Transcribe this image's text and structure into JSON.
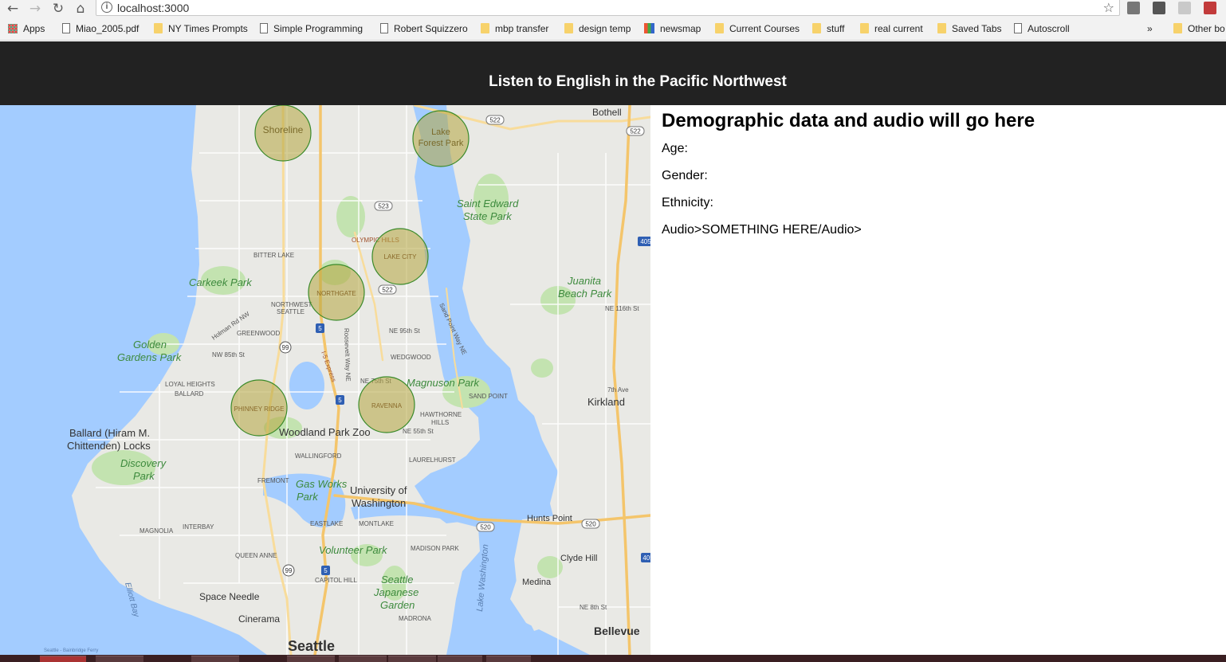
{
  "browser": {
    "url": "localhost:3000",
    "bookmarks": [
      {
        "label": "Apps",
        "icon": "apps-grid-icon"
      },
      {
        "label": "Miao_2005.pdf",
        "icon": "page-icon"
      },
      {
        "label": "NY Times Prompts",
        "icon": "folder-icon"
      },
      {
        "label": "Simple Programming",
        "icon": "page-icon"
      },
      {
        "label": "Robert Squizzero",
        "icon": "page-icon"
      },
      {
        "label": "mbp transfer",
        "icon": "folder-icon"
      },
      {
        "label": "design temp",
        "icon": "folder-icon"
      },
      {
        "label": "newsmap",
        "icon": "newsmap-icon"
      },
      {
        "label": "Current Courses",
        "icon": "folder-icon"
      },
      {
        "label": "stuff",
        "icon": "folder-icon"
      },
      {
        "label": "real current",
        "icon": "folder-icon"
      },
      {
        "label": "Saved Tabs",
        "icon": "folder-icon"
      },
      {
        "label": "Autoscroll",
        "icon": "page-icon"
      }
    ],
    "overflow": "»",
    "other_bookmarks": "Other bo"
  },
  "header": {
    "title": "Listen to English in the Pacific Northwest"
  },
  "map": {
    "neighborhood_markers": [
      {
        "label": "Shoreline"
      },
      {
        "label": "Lake Forest Park"
      },
      {
        "label": "LAKE CITY"
      },
      {
        "label": "NORTHGATE"
      },
      {
        "label": "PHINNEY RIDGE"
      },
      {
        "label": "RAVENNA"
      }
    ],
    "marker_fill": "#b5a640",
    "marker_stroke": "#3a8a2a",
    "place_labels": {
      "bothell": "Bothell",
      "saint_edward": "Saint Edward",
      "state_park": "State Park",
      "olympic_hills": "OLYMPIC HILLS",
      "bitter_lake": "BITTER LAKE",
      "carkeek": "Carkeek Park",
      "juanita": "Juanita",
      "beach_park": "Beach Park",
      "ne116": "NE 116th St",
      "northwest_seattle_1": "NORTHWEST",
      "northwest_seattle_2": "SEATTLE",
      "greenwood": "GREENWOOD",
      "ne95": "NE 95th St",
      "golden": "Golden",
      "gardens_park": "Gardens Park",
      "nw85": "NW 85th St",
      "wedgwood": "WEDGWOOD",
      "loyal_heights": "LOYAL HEIGHTS",
      "ballard": "BALLARD",
      "ne75": "NE 75th St",
      "magnuson": "Magnuson Park",
      "sand_point": "SAND POINT",
      "kirkland": "Kirkland",
      "seventh_ave": "7th Ave",
      "hawthorne_1": "HAWTHORNE",
      "hawthorne_2": "HILLS",
      "ballard_locks_1": "Ballard (Hiram M.",
      "ballard_locks_2": "Chittenden) Locks",
      "woodland": "Woodland Park Zoo",
      "ne55": "NE 55th St",
      "wallingford": "WALLINGFORD",
      "laurelhurst": "LAURELHURST",
      "discovery_1": "Discovery",
      "discovery_2": "Park",
      "fremont": "FREMONT",
      "gas_works_1": "Gas Works",
      "gas_works_2": "Park",
      "uw_1": "University of",
      "uw_2": "Washington",
      "magnolia": "MAGNOLIA",
      "interbay": "INTERBAY",
      "eastlake": "EASTLAKE",
      "montlake": "MONTLAKE",
      "hunts_point": "Hunts Point",
      "lake_washington": "Lake Washington",
      "queen_anne": "QUEEN ANNE",
      "volunteer": "Volunteer Park",
      "madison_park": "MADISON PARK",
      "clyde_hill": "Clyde Hill",
      "capitol_hill": "CAPITOL HILL",
      "seattle_japanese_1": "Seattle",
      "seattle_japanese_2": "Japanese",
      "seattle_japanese_3": "Garden",
      "medina": "Medina",
      "space_needle": "Space Needle",
      "elliott_bay": "Elliott Bay",
      "cinerama": "Cinerama",
      "madrona": "MADRONA",
      "ne8": "NE 8th St",
      "seattle": "Seattle",
      "bellevue": "Bellevue",
      "ferry": "Seattle - Bainbridge Ferry",
      "i5_express": "I-5 Express",
      "sand_point_way": "Sand Point Way NE",
      "holman": "Holman Rd NW",
      "roosevelt": "Roosevelt Way NE"
    },
    "highway_shields": [
      "522",
      "522",
      "523",
      "522",
      "405",
      "5",
      "99",
      "5",
      "520",
      "520",
      "99",
      "5",
      "405"
    ]
  },
  "panel": {
    "heading": "Demographic data and audio will go here",
    "age_label": "Age:",
    "gender_label": "Gender:",
    "ethnicity_label": "Ethnicity:",
    "audio_label": "Audio>SOMETHING HERE/Audio>"
  },
  "colors": {
    "header_bg": "#222222",
    "water": "#a3ccff",
    "land": "#e9e9e5",
    "park": "#c3e3b0"
  }
}
